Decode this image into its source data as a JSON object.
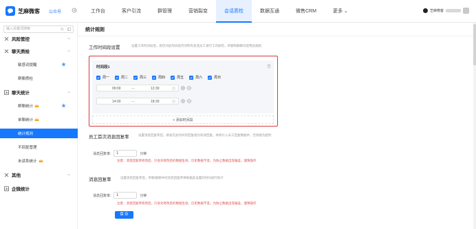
{
  "header": {
    "brand": "芝麻微客",
    "pub_label": "公众号",
    "nav": [
      "工作台",
      "客户引流",
      "群管理",
      "营销裂变",
      "会话质检",
      "数据互通",
      "微售CRM",
      "更多"
    ],
    "active_nav": 4,
    "user_name": "芝麻微客"
  },
  "sidebar": {
    "search_placeholder": "输入关键词搜索",
    "items": [
      {
        "type": "group",
        "label": "风险管控",
        "icon": "x-icon",
        "expanded": false
      },
      {
        "type": "group",
        "label": "聊天质检",
        "icon": "x-icon",
        "expanded": true
      },
      {
        "type": "sub",
        "label": "敏感词提醒",
        "star": true
      },
      {
        "type": "sub",
        "label": "群聊质检"
      },
      {
        "type": "group",
        "label": "聊天统计",
        "icon": "chart-icon",
        "expanded": true
      },
      {
        "type": "sub",
        "label": "群聊统计",
        "crown": true,
        "star": true
      },
      {
        "type": "sub",
        "label": "单聊统计",
        "crown": true
      },
      {
        "type": "sub",
        "label": "统计规则",
        "active": true
      },
      {
        "type": "sub",
        "label": "不回复管理"
      },
      {
        "type": "sub",
        "label": "未读系统计",
        "crown": true
      },
      {
        "type": "group",
        "label": "其他",
        "icon": "x-icon",
        "expanded": false
      },
      {
        "type": "group",
        "label": "企微统计",
        "icon": "chart-icon"
      }
    ]
  },
  "main": {
    "title": "统计规则",
    "work_time": {
      "title": "工作时间段设置",
      "desc": "设置工作时间段后，则仅对此时间段内对所有会话员工进行工作质检，单聊和群聊均适用此规则",
      "card_title": "时间段1",
      "days": [
        "周一",
        "周二",
        "周三",
        "周四",
        "周五",
        "周六",
        "周日"
      ],
      "ranges": [
        {
          "start": "09:00",
          "end": "12:30"
        },
        {
          "start": "14:00",
          "end": "18:30"
        }
      ],
      "add_label": "+ 添加时间段"
    },
    "staff_reply": {
      "title": "员工首次消息回复率",
      "desc": "设置消息回复率后，即会在此时间内回复视为有效回复，并统计入员工回复数据中，否则视为超时",
      "label": "消息回复率:",
      "value": "1",
      "unit": "分钟",
      "note": "注意：消息回复率修改后，只会对修改后的数据生效，历史数据不变，为防止数据出现偏差，谨慎操作"
    },
    "msg_reply": {
      "title": "消息回复率",
      "desc": "设置消息回复率后，单聊/群聊中的消息回复率将根据此设置的时间进行统计",
      "label": "消息回复率:",
      "value": "1",
      "unit": "分钟",
      "note": "注意：消息回复率修改后，只会对修改后的数据生效，历史数据不变，为防止数据出现偏差，谨慎操作"
    },
    "save_label": "保 存"
  },
  "colors": {
    "accent": "#1677ff",
    "danger": "#d9363e",
    "gold": "#f5a623"
  }
}
